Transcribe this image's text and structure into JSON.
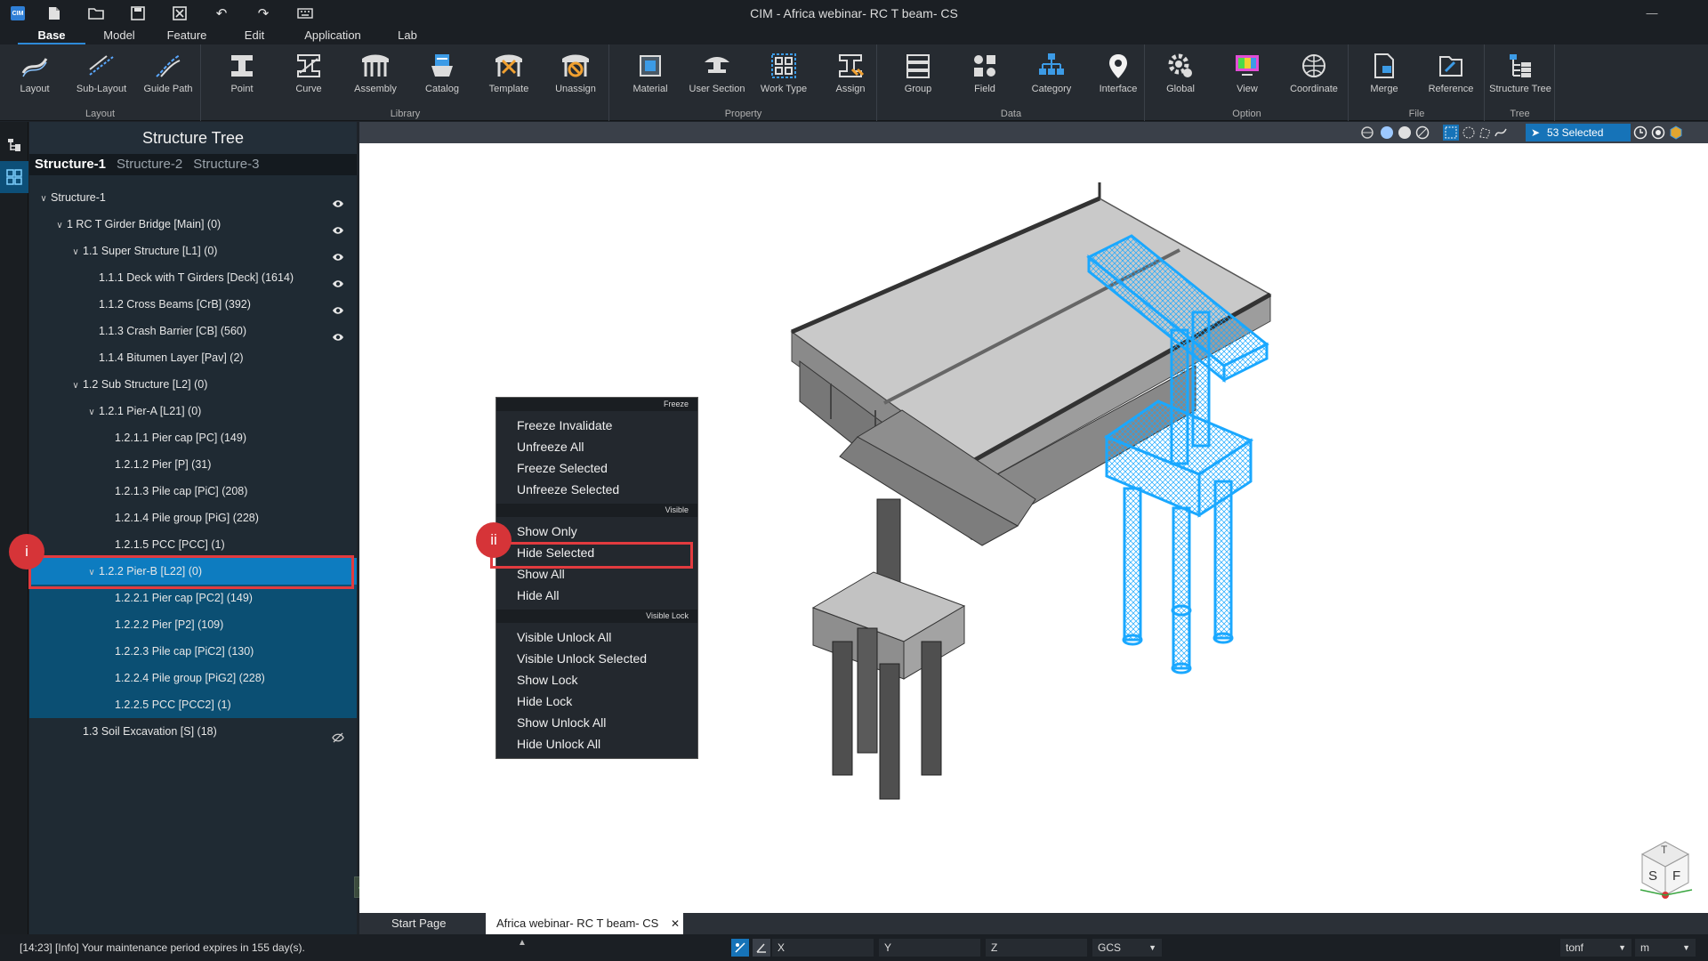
{
  "window": {
    "title": "CIM - Africa webinar- RC T beam- CS",
    "app_badge": "CIM"
  },
  "menu": {
    "tabs": [
      "Base",
      "Model",
      "Feature",
      "Edit",
      "Application",
      "Lab"
    ],
    "active": "Base"
  },
  "ribbon": {
    "groups": [
      {
        "label": "Layout",
        "tools": [
          "Layout",
          "Sub-Layout",
          "Guide Path"
        ]
      },
      {
        "label": "Library",
        "tools": [
          "Point",
          "Curve",
          "Assembly",
          "Catalog",
          "Template",
          "Unassign"
        ]
      },
      {
        "label": "Property",
        "tools": [
          "Material",
          "User Section",
          "Work Type",
          "Assign"
        ]
      },
      {
        "label": "Data",
        "tools": [
          "Group",
          "Field",
          "Category",
          "Interface"
        ]
      },
      {
        "label": "Option",
        "tools": [
          "Global",
          "View",
          "Coordinate"
        ]
      },
      {
        "label": "File",
        "tools": [
          "Merge",
          "Reference"
        ]
      },
      {
        "label": "Tree",
        "tools": [
          "Structure Tree"
        ]
      }
    ]
  },
  "tree": {
    "title": "Structure Tree",
    "tabs": [
      "Structure-1",
      "Structure-2",
      "Structure-3"
    ],
    "rows": [
      {
        "label": "Structure-1",
        "chev": "∨"
      },
      {
        "label": "1 RC T Girder Bridge [Main] (0)",
        "chev": "∨"
      },
      {
        "label": "1.1 Super Structure [L1] (0)",
        "chev": "∨"
      },
      {
        "label": "1.1.1 Deck with T Girders [Deck] (1614)"
      },
      {
        "label": "1.1.2 Cross Beams [CrB] (392)"
      },
      {
        "label": "1.1.3 Crash Barrier [CB] (560)"
      },
      {
        "label": "1.1.4 Bitumen Layer [Pav] (2)"
      },
      {
        "label": "1.2 Sub Structure [L2] (0)",
        "chev": "∨"
      },
      {
        "label": "1.2.1 Pier-A [L21] (0)",
        "chev": "∨"
      },
      {
        "label": "1.2.1.1 Pier cap [PC] (149)"
      },
      {
        "label": "1.2.1.2 Pier  [P] (31)"
      },
      {
        "label": "1.2.1.3 Pile cap [PiC] (208)"
      },
      {
        "label": "1.2.1.4 Pile group [PiG] (228)"
      },
      {
        "label": "1.2.1.5 PCC [PCC] (1)"
      },
      {
        "label": "1.2.2 Pier-B [L22] (0)",
        "chev": "∨"
      },
      {
        "label": "1.2.2.1 Pier cap [PC2] (149)"
      },
      {
        "label": "1.2.2.2 Pier  [P2] (109)"
      },
      {
        "label": "1.2.2.3 Pile cap [PiC2] (130)"
      },
      {
        "label": "1.2.2.4 Pile group [PiG2] (228)"
      },
      {
        "label": "1.2.2.5 PCC [PCC2] (1)"
      },
      {
        "label": "1.3 Soil Excavation [S] (18)"
      }
    ]
  },
  "viewport": {
    "selected": "53 Selected"
  },
  "context_menu": {
    "sections": [
      {
        "header": "Freeze",
        "items": [
          "Freeze Invalidate",
          "Unfreeze All",
          "Freeze Selected",
          "Unfreeze Selected"
        ]
      },
      {
        "header": "Visible",
        "items": [
          "Show Only",
          "Hide Selected",
          "Show All",
          "Hide All"
        ]
      },
      {
        "header": "Visible Lock",
        "items": [
          "Visible Unlock All",
          "Visible Unlock Selected",
          "Show Lock",
          "Hide Lock",
          "Show Unlock All",
          "Hide Unlock All"
        ]
      }
    ]
  },
  "markers": {
    "tree": "i",
    "menu": "ii"
  },
  "doc_tabs": [
    "Start Page",
    "Africa webinar- RC T beam- CS"
  ],
  "status": {
    "message": "[14:23] [Info] Your maintenance period expires in 155 day(s).",
    "x_label": "X",
    "y_label": "Y",
    "z_label": "Z",
    "coord_system": "GCS",
    "force_unit": "tonf",
    "length_unit": "m"
  },
  "viewcube": {
    "labels": [
      "T",
      "S",
      "F"
    ]
  },
  "colors": {
    "accent": "#2d8ad8",
    "selection": "#1aa8ff",
    "highlight_box": "#e23b3f"
  }
}
